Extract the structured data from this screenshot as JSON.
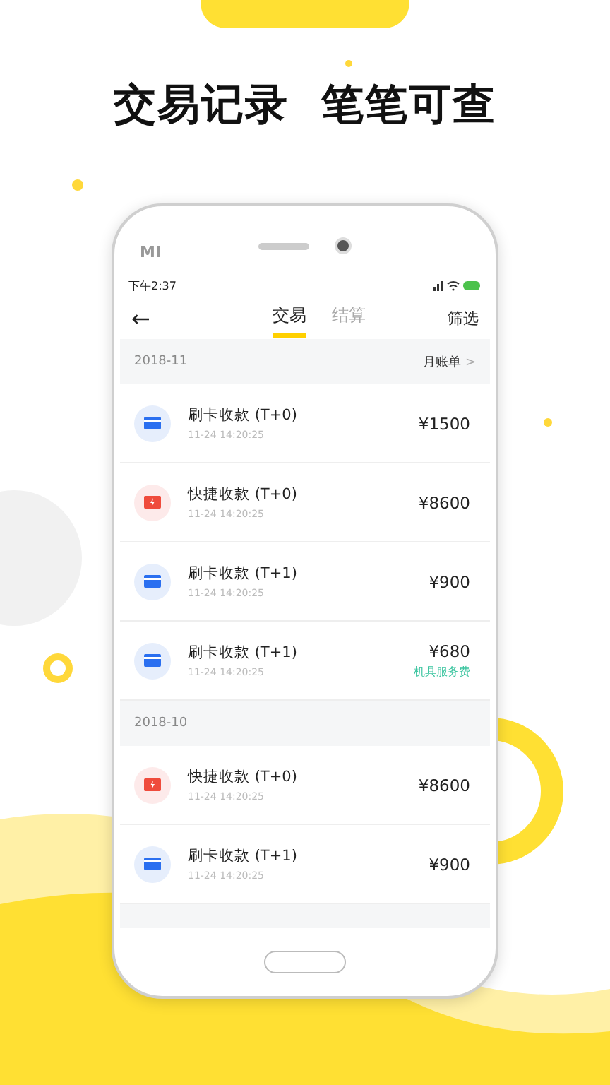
{
  "headline": "交易记录  笔笔可查",
  "device_logo": "MI",
  "status_bar": {
    "time": "下午2:37"
  },
  "nav": {
    "back": "←",
    "tabs": [
      {
        "label": "交易",
        "selected": true
      },
      {
        "label": "结算",
        "selected": false
      }
    ],
    "action": "筛选"
  },
  "sections": [
    {
      "month": "2018-11",
      "link": "月账单",
      "link_arrow": ">",
      "rows": [
        {
          "kind": "card",
          "title": "刷卡收款 (T+0)",
          "time": "11-24  14:20:25",
          "amount": "¥1500"
        },
        {
          "kind": "quick",
          "title": "快捷收款 (T+0)",
          "time": "11-24  14:20:25",
          "amount": "¥8600"
        },
        {
          "kind": "card",
          "title": "刷卡收款 (T+1)",
          "time": "11-24  14:20:25",
          "amount": "¥900"
        },
        {
          "kind": "card",
          "title": "刷卡收款 (T+1)",
          "time": "11-24  14:20:25",
          "amount": "¥680",
          "note": "机具服务费"
        }
      ]
    },
    {
      "month": "2018-10",
      "rows": [
        {
          "kind": "quick",
          "title": "快捷收款 (T+0)",
          "time": "11-24  14:20:25",
          "amount": "¥8600"
        },
        {
          "kind": "card",
          "title": "刷卡收款 (T+1)",
          "time": "11-24  14:20:25",
          "amount": "¥900"
        }
      ]
    }
  ]
}
